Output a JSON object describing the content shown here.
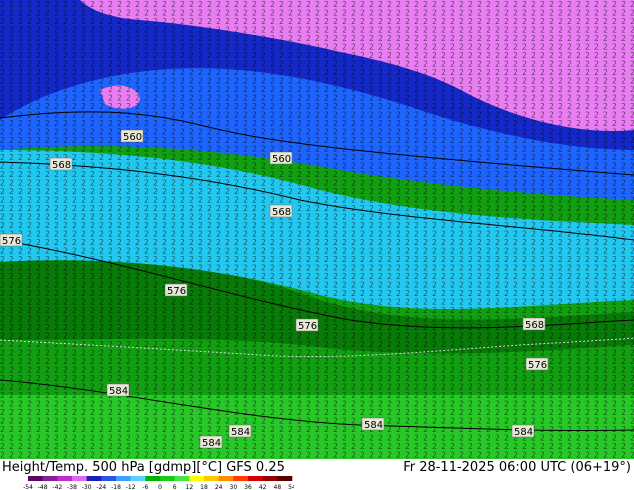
{
  "header": {
    "left_title": "Height/Temp. 500 hPa [gdmp][°C] GFS 0.25",
    "right_title": "Fr 28-11-2025 06:00 UTC (06+19°)"
  },
  "map": {
    "contour_labels": [
      "560",
      "560",
      "568",
      "568",
      "576",
      "576",
      "576",
      "568",
      "576",
      "584",
      "584",
      "584",
      "584"
    ],
    "contour_color": "#000000"
  },
  "colorbar": {
    "ticks": [
      "-54",
      "-48",
      "-42",
      "-38",
      "-30",
      "-24",
      "-18",
      "-12",
      "-6",
      "0",
      "6",
      "12",
      "18",
      "24",
      "30",
      "36",
      "42",
      "48",
      "54"
    ],
    "colors": [
      "#5a0a5a",
      "#8a1f9a",
      "#c02bd0",
      "#e066f0",
      "#1e1eb4",
      "#2a55e6",
      "#3ca0ff",
      "#5ed0ff",
      "#00b400",
      "#19c819",
      "#46e646",
      "#ffff00",
      "#ffc800",
      "#ff8c00",
      "#ff3c00",
      "#d20000",
      "#960000",
      "#5a0000"
    ]
  },
  "colors": {
    "magenta_region": "#e87ef2",
    "dark_blue_region": "#1428c8",
    "blue_region": "#1e64ff",
    "cyan_region": "#22c8f0",
    "dark_green_region": "#087a08",
    "green_region": "#12a012",
    "light_green_region": "#28c828"
  }
}
